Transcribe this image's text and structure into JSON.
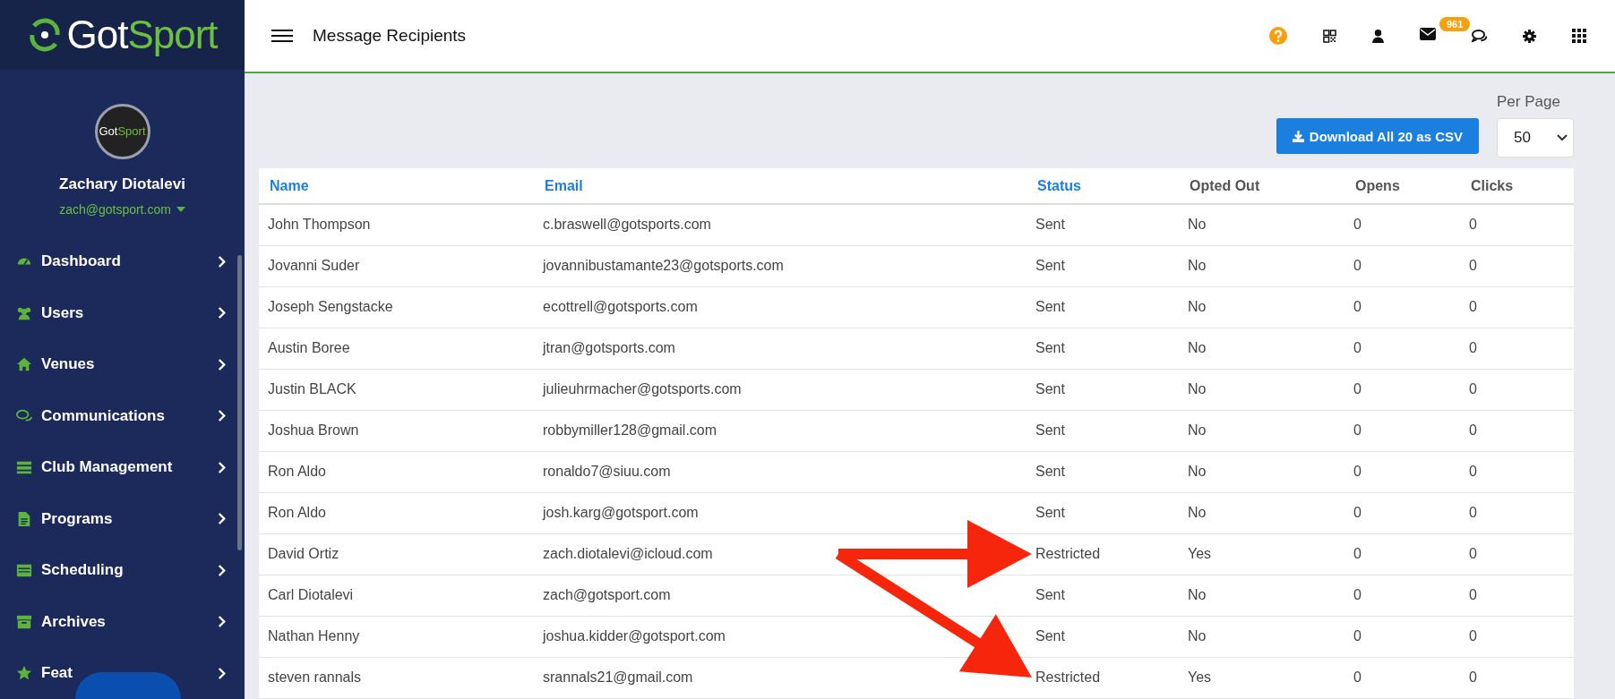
{
  "sidebar": {
    "logo": {
      "part_1": "Got",
      "part_2": "Sport"
    },
    "avatar_text": {
      "part_1": "Got",
      "part_2": "Sport"
    },
    "user_name": "Zachary Diotalevi",
    "user_email": "zach@gotsport.com",
    "items": [
      {
        "label": "Dashboard"
      },
      {
        "label": "Users"
      },
      {
        "label": "Venues"
      },
      {
        "label": "Communications"
      },
      {
        "label": "Club Management"
      },
      {
        "label": "Programs"
      },
      {
        "label": "Scheduling"
      },
      {
        "label": "Archives"
      },
      {
        "label": "Feat"
      }
    ]
  },
  "topbar": {
    "title": "Message Recipients",
    "mail_badge": "961"
  },
  "toolbar": {
    "download_button": "Download All 20 as CSV",
    "per_page_label": "Per Page",
    "per_page_value": "50"
  },
  "table": {
    "columns": [
      {
        "label": "Name",
        "sortable": true
      },
      {
        "label": "Email",
        "sortable": true
      },
      {
        "label": "Status",
        "sortable": true
      },
      {
        "label": "Opted Out",
        "sortable": false
      },
      {
        "label": "Opens",
        "sortable": false
      },
      {
        "label": "Clicks",
        "sortable": false
      }
    ],
    "rows": [
      {
        "cells": [
          "John Thompson",
          "c.braswell@gotsports.com",
          "Sent",
          "No",
          "0",
          "0"
        ],
        "arrow": false
      },
      {
        "cells": [
          "Jovanni Suder",
          "jovannibustamante23@gotsports.com",
          "Sent",
          "No",
          "0",
          "0"
        ],
        "arrow": false
      },
      {
        "cells": [
          "Joseph Sengstacke",
          "ecottrell@gotsports.com",
          "Sent",
          "No",
          "0",
          "0"
        ],
        "arrow": false
      },
      {
        "cells": [
          "Austin Boree",
          "jtran@gotsports.com",
          "Sent",
          "No",
          "0",
          "0"
        ],
        "arrow": false
      },
      {
        "cells": [
          "Justin BLACK",
          "julieuhrmacher@gotsports.com",
          "Sent",
          "No",
          "0",
          "0"
        ],
        "arrow": false
      },
      {
        "cells": [
          "Joshua Brown",
          "robbymiller128@gmail.com",
          "Sent",
          "No",
          "0",
          "0"
        ],
        "arrow": false
      },
      {
        "cells": [
          "Ron Aldo",
          "ronaldo7@siuu.com",
          "Sent",
          "No",
          "0",
          "0"
        ],
        "arrow": false
      },
      {
        "cells": [
          "Ron Aldo",
          "josh.karg@gotsport.com",
          "Sent",
          "No",
          "0",
          "0"
        ],
        "arrow": false
      },
      {
        "cells": [
          "David Ortiz",
          "zach.diotalevi@icloud.com",
          "Restricted",
          "Yes",
          "0",
          "0"
        ],
        "arrow": true
      },
      {
        "cells": [
          "Carl Diotalevi",
          "zach@gotsport.com",
          "Sent",
          "No",
          "0",
          "0"
        ],
        "arrow": false
      },
      {
        "cells": [
          "Nathan Henny",
          "joshua.kidder@gotsport.com",
          "Sent",
          "No",
          "0",
          "0"
        ],
        "arrow": false
      },
      {
        "cells": [
          "steven rannals",
          "srannals21@gmail.com",
          "Restricted",
          "Yes",
          "0",
          "0"
        ],
        "arrow": true
      }
    ]
  }
}
